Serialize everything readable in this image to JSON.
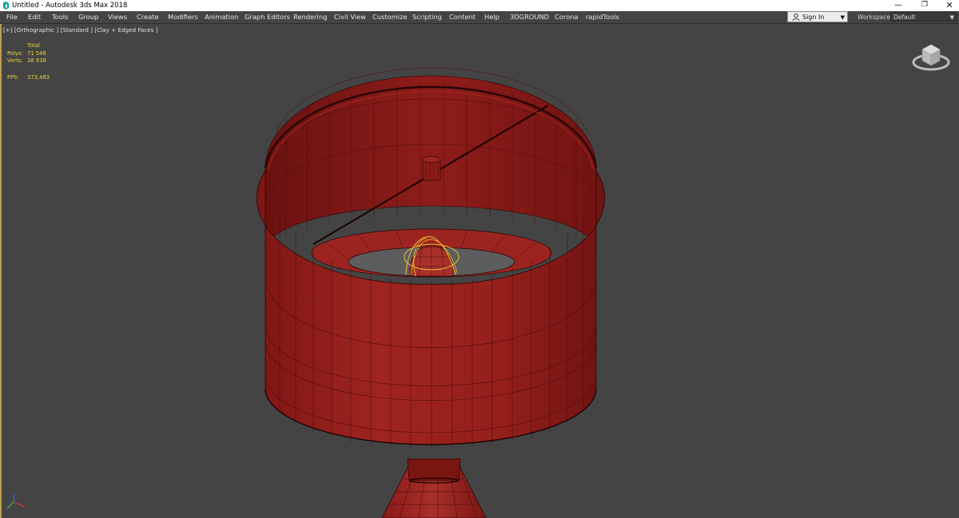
{
  "window": {
    "title": "Untitled - Autodesk 3ds Max 2018",
    "minimize": "—",
    "maximize": "❐",
    "close": "✕"
  },
  "menu": {
    "items": [
      {
        "label": "File"
      },
      {
        "label": "Edit"
      },
      {
        "label": "Tools"
      },
      {
        "label": "Group"
      },
      {
        "label": "Views"
      },
      {
        "label": "Create"
      },
      {
        "label": "Modifiers"
      },
      {
        "label": "Animation"
      },
      {
        "label": "Graph Editors"
      },
      {
        "label": "Rendering"
      },
      {
        "label": "Civil View"
      },
      {
        "label": "Customize"
      },
      {
        "label": "Scripting"
      },
      {
        "label": "Content"
      },
      {
        "label": "Help"
      },
      {
        "label": "3DGROUND"
      },
      {
        "label": "Corona"
      },
      {
        "label": "rapidTools"
      }
    ],
    "signin_label": "Sign In",
    "workspaces_label": "Workspaces:",
    "workspace_value": "Default",
    "dropdown_icon": "▼"
  },
  "viewport": {
    "label": "[+] [Orthographic ] [Standard ] [Clay + Edged Faces ]",
    "stats": {
      "header": "Total",
      "polys_label": "Polys:",
      "polys_value": "71 546",
      "verts_label": "Verts:",
      "verts_value": "38 938",
      "fps_label": "FPS:",
      "fps_value": "373,483"
    }
  },
  "colors": {
    "viewport_bg": "#444444",
    "object_red": "#8e1d1a",
    "object_red_light": "#a32420",
    "object_red_dark": "#5e100e",
    "edge": "#2a0605",
    "selection": "#e8c23a",
    "stats_text": "#e6d23a",
    "active_border": "#b8a04a"
  },
  "icons": {
    "app": "3dsmax-app-icon",
    "user": "user-icon",
    "viewcube": "viewcube-icon",
    "axis": "axis-tripod-icon"
  }
}
